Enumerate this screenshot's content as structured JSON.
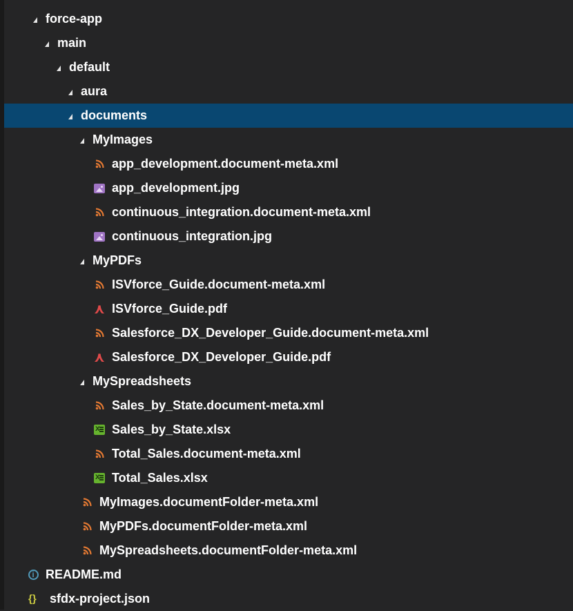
{
  "explorer": {
    "colors": {
      "background": "#252526",
      "selection": "#094771",
      "xml_icon": "#e37933",
      "image_icon": "#a074c4",
      "pdf_icon": "#e04a4a",
      "xlsx_icon": "#66b32e",
      "info_icon": "#519aba",
      "json_icon": "#cbcb41"
    },
    "items": [
      {
        "label": "force-app",
        "type": "folder",
        "depth": 0,
        "expanded": true
      },
      {
        "label": "main",
        "type": "folder",
        "depth": 1,
        "expanded": true
      },
      {
        "label": "default",
        "type": "folder",
        "depth": 2,
        "expanded": true
      },
      {
        "label": "aura",
        "type": "folder",
        "depth": 3,
        "expanded": true
      },
      {
        "label": "documents",
        "type": "folder",
        "depth": 3,
        "expanded": true,
        "selected": true
      },
      {
        "label": "MyImages",
        "type": "folder",
        "depth": 4,
        "expanded": true
      },
      {
        "label": "app_development.document-meta.xml",
        "type": "xml",
        "depth": 5
      },
      {
        "label": "app_development.jpg",
        "type": "image",
        "depth": 5
      },
      {
        "label": "continuous_integration.document-meta.xml",
        "type": "xml",
        "depth": 5
      },
      {
        "label": "continuous_integration.jpg",
        "type": "image",
        "depth": 5
      },
      {
        "label": "MyPDFs",
        "type": "folder",
        "depth": 4,
        "expanded": true
      },
      {
        "label": "ISVforce_Guide.document-meta.xml",
        "type": "xml",
        "depth": 5
      },
      {
        "label": "ISVforce_Guide.pdf",
        "type": "pdf",
        "depth": 5
      },
      {
        "label": "Salesforce_DX_Developer_Guide.document-meta.xml",
        "type": "xml",
        "depth": 5
      },
      {
        "label": "Salesforce_DX_Developer_Guide.pdf",
        "type": "pdf",
        "depth": 5
      },
      {
        "label": "MySpreadsheets",
        "type": "folder",
        "depth": 4,
        "expanded": true
      },
      {
        "label": "Sales_by_State.document-meta.xml",
        "type": "xml",
        "depth": 5
      },
      {
        "label": "Sales_by_State.xlsx",
        "type": "xlsx",
        "depth": 5
      },
      {
        "label": "Total_Sales.document-meta.xml",
        "type": "xml",
        "depth": 5
      },
      {
        "label": "Total_Sales.xlsx",
        "type": "xlsx",
        "depth": 5
      },
      {
        "label": "MyImages.documentFolder-meta.xml",
        "type": "xml",
        "depth": 4
      },
      {
        "label": "MyPDFs.documentFolder-meta.xml",
        "type": "xml",
        "depth": 4
      },
      {
        "label": "MySpreadsheets.documentFolder-meta.xml",
        "type": "xml",
        "depth": 4
      },
      {
        "label": "README.md",
        "type": "info",
        "depth": 0
      },
      {
        "label": "sfdx-project.json",
        "type": "json",
        "depth": 0
      }
    ]
  }
}
